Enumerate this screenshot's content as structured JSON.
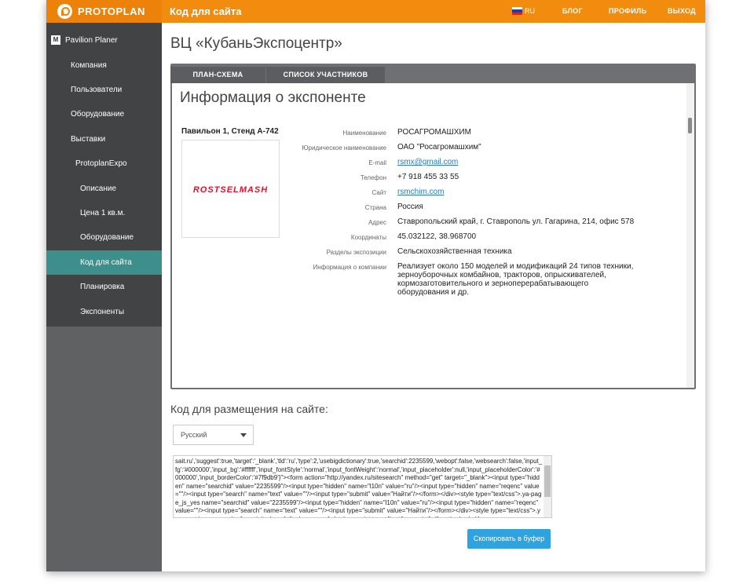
{
  "brand": {
    "name": "PROTOPLAN"
  },
  "header": {
    "title": "Код для сайта",
    "lang": "RU",
    "nav": [
      "БЛОГ",
      "ПРОФИЛЬ",
      "ВЫХОД"
    ],
    "flag_colors": [
      "#ffffff",
      "#1c3fa8",
      "#d52b1e"
    ]
  },
  "sidebar": {
    "app_name": "Pavilion Planer",
    "app_icon_letter": "M",
    "items": [
      {
        "label": "Компания"
      },
      {
        "label": "Пользователи"
      },
      {
        "label": "Оборудование"
      },
      {
        "label": "Выставки"
      },
      {
        "label": "ProtoplanExpo"
      },
      {
        "label": "Описание"
      },
      {
        "label": "Цена 1 кв.м."
      },
      {
        "label": "Оборудование"
      },
      {
        "label": "Код для сайта",
        "active": true
      },
      {
        "label": "Планировка"
      },
      {
        "label": "Экспоненты"
      }
    ]
  },
  "main": {
    "page_title": "ВЦ «КубаньЭкспоцентр»",
    "tabs": [
      {
        "label": "ПЛАН-СХЕМА"
      },
      {
        "label": "СПИСОК УЧАСТНИКОВ"
      }
    ],
    "exhibitor": {
      "heading": "Информация о экспоненте",
      "stand": "Павильон 1, Стенд  А-742",
      "logo_text": "ROSTSELMASH",
      "fields": [
        {
          "label": "Наименование",
          "value": "РОСАГРОМАШХИМ"
        },
        {
          "label": "Юридическое наименование",
          "value": "ОАО \"Росагромашхим\""
        },
        {
          "label": "E-mail",
          "value": "rsmx@gmail.com",
          "link": true
        },
        {
          "label": "Телефон",
          "value": "+7 918 455 33 55"
        },
        {
          "label": "Сайт",
          "value": "rsmchim.com",
          "link": true
        },
        {
          "label": "Страна",
          "value": "Россия"
        },
        {
          "label": "Адрес",
          "value": "Ставропольский край, г. Ставрополь ул. Гагарина, 214, офис 578"
        },
        {
          "label": "Координаты",
          "value": "45.032122, 38.968700"
        },
        {
          "label": "Разделы экспозиции",
          "value": "Сельскохозяйственная техника"
        },
        {
          "label": "Информация о компании",
          "value": "Реализует около 150 моделей и модификаций 24 типов техники, зерноуборочных комбайнов, тракторов, опрыскивателей, кормозаготовительного и зерноперерабатывающего оборудования и др."
        }
      ]
    },
    "embed": {
      "title": "Код для размещения на сайте:",
      "language_select": "Русский",
      "code": "sait.ru','suggest':true,'target':'_blank','tld':'ru','type':2,'usebigdictionary':true,'searchid':2235599,'webopt':false,'websearch':false,'input_fg':'#000000','input_bg':'#ffffff','input_fontStyle':'normal','input_fontWeight':'normal','input_placeholder':null,'input_placeholderColor':'#000000','input_borderColor':'#7f9db9'}\"><form action=\"http://yandex.ru/sitesearch\" method=\"get\" target=\"_blank\"><input type=\"hidden\" name=\"searchid\" value=\"2235599\"/><input type=\"hidden\" name=\"l10n\" value=\"ru\"/><input type=\"hidden\" name=\"reqenc\" value=\"\"/><input type=\"search\" name=\"text\" value=\"\"/><input type=\"submit\" value=\"Найти\"/></form></div><style type=\"text/css\">.ya-page_js_yes name=\"searchid\" value=\"2235599\"/><input type=\"hidden\" name=\"l10n\" value=\"ru\"/><input type=\"hidden\" name=\"reqenc\" value=\"\"/><input type=\"search\" name=\"text\" value=\"\"/><input type=\"submit\" value=\"Найти\"/></form></div><style type=\"text/css\">.ya-page_js_yes .ya-site-form_inited_no { display: none; }</style><script type=\"text/javascript\">(function(w,d,c){var",
      "copy_button": "Скопировать в буфер"
    }
  }
}
